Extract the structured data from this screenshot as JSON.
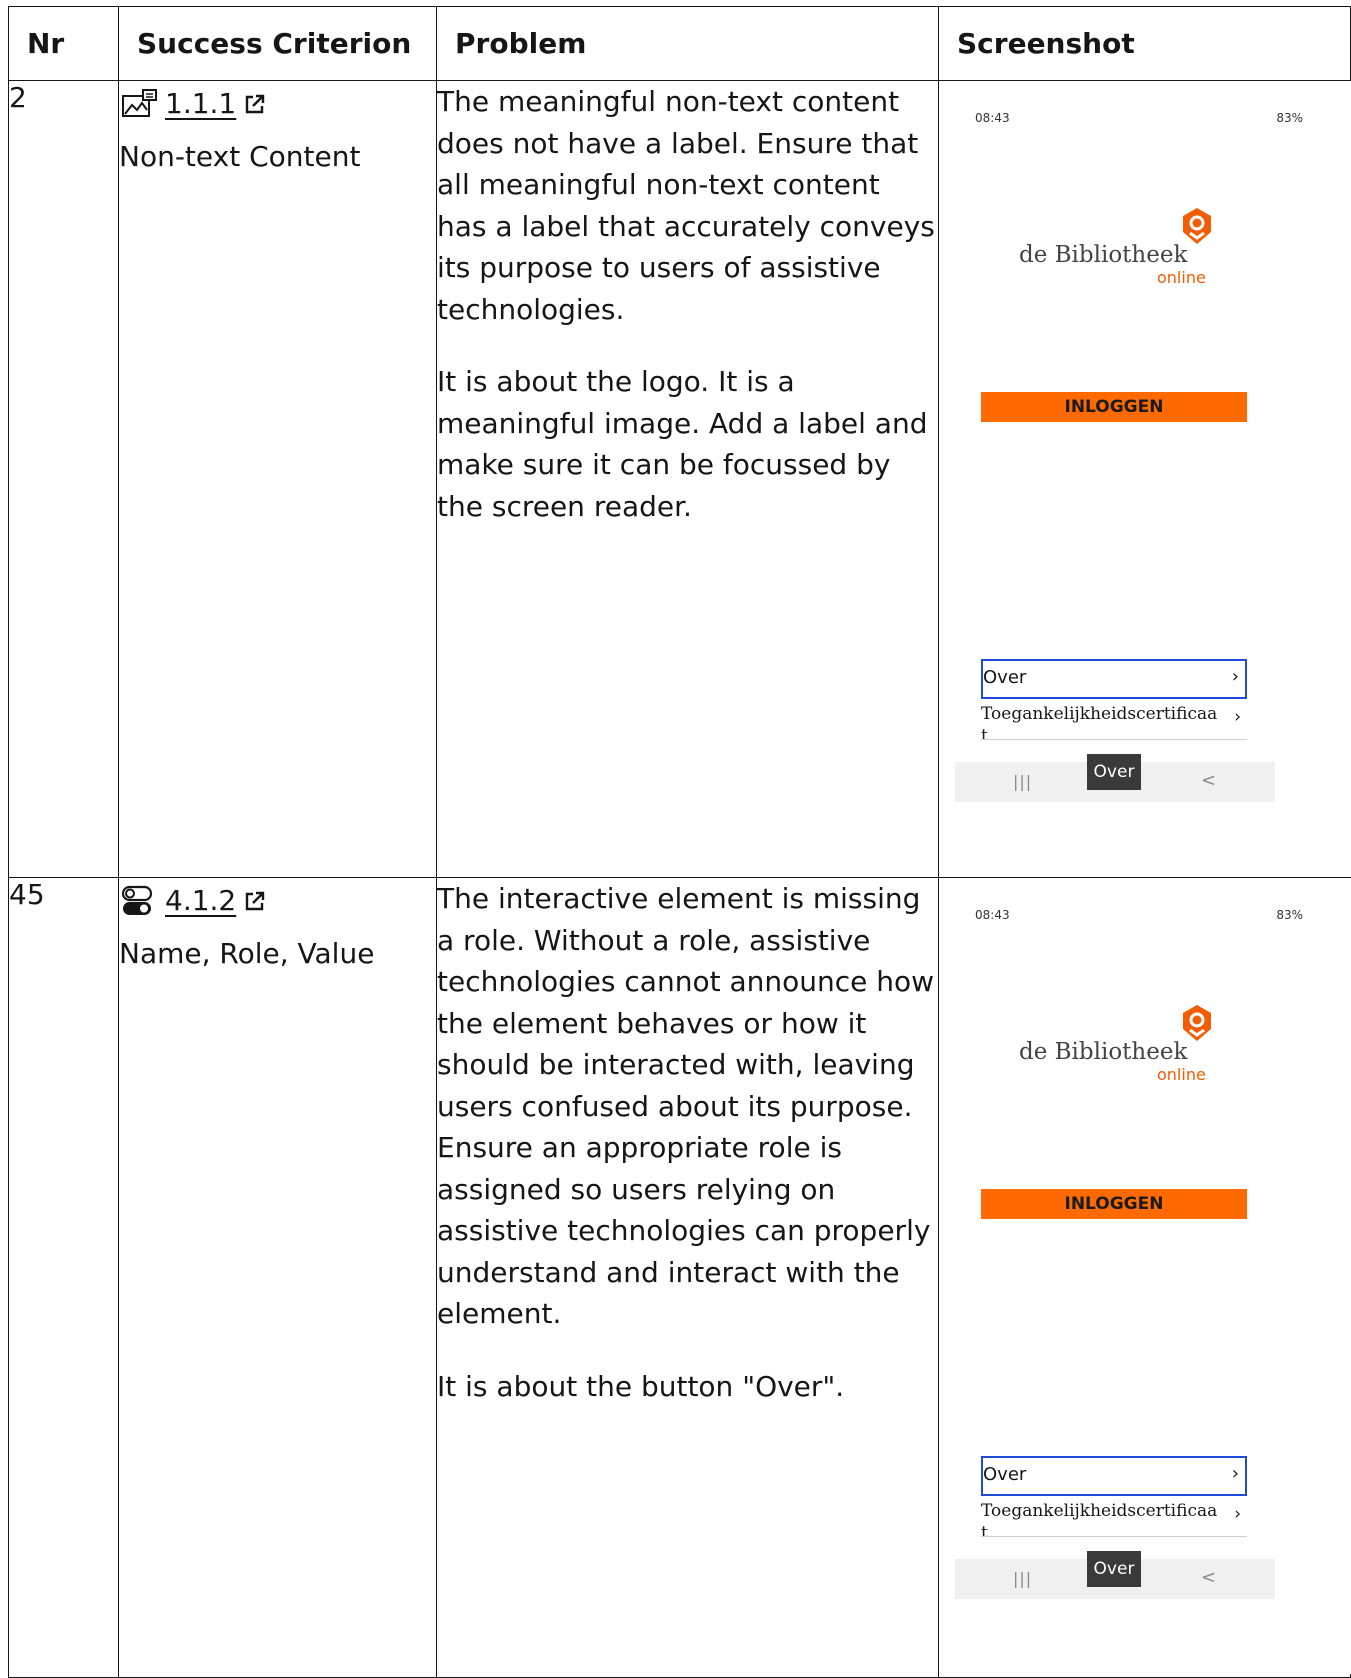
{
  "headers": {
    "nr": "Nr",
    "sc": "Success Criterion",
    "problem": "Problem",
    "screenshot": "Screenshot"
  },
  "rows": [
    {
      "nr": "2",
      "sc_number": "1.1.1",
      "sc_name": "Non-text Content",
      "sc_icon": "image-icon",
      "problem_p1": "The meaningful non-text content does not have a label. Ensure that all meaningful non-text content has a label that accurately conveys its purpose to users of assistive technologies.",
      "problem_p2": "It is about the logo. It is a meaningful image. Add a label and make sure it can be focussed by the screen reader."
    },
    {
      "nr": "45",
      "sc_number": "4.1.2",
      "sc_name": "Name, Role, Value",
      "sc_icon": "toggle-icon",
      "problem_p1": "The interactive element is missing a role. Without a role, assistive technologies cannot announce how the element behaves or how it should be interacted with, leaving users confused about its purpose. Ensure an appropriate role is assigned so users relying on assistive technologies can properly understand and interact with the element.",
      "problem_p2": "It is about the button \"Over\"."
    }
  ],
  "phone": {
    "time": "08:43",
    "status_right": "83%",
    "brand": "de Bibliotheek",
    "brand_sub": "online",
    "login_label": "INLOGGEN",
    "menu_over": "Over",
    "menu_toeg": "Toegankelijkheidscertificaat",
    "nav_recent": "|||",
    "nav_back": "<",
    "tooltip": "Over",
    "brand_color": "#ff6a00",
    "focus_color": "#1f4bd8"
  }
}
